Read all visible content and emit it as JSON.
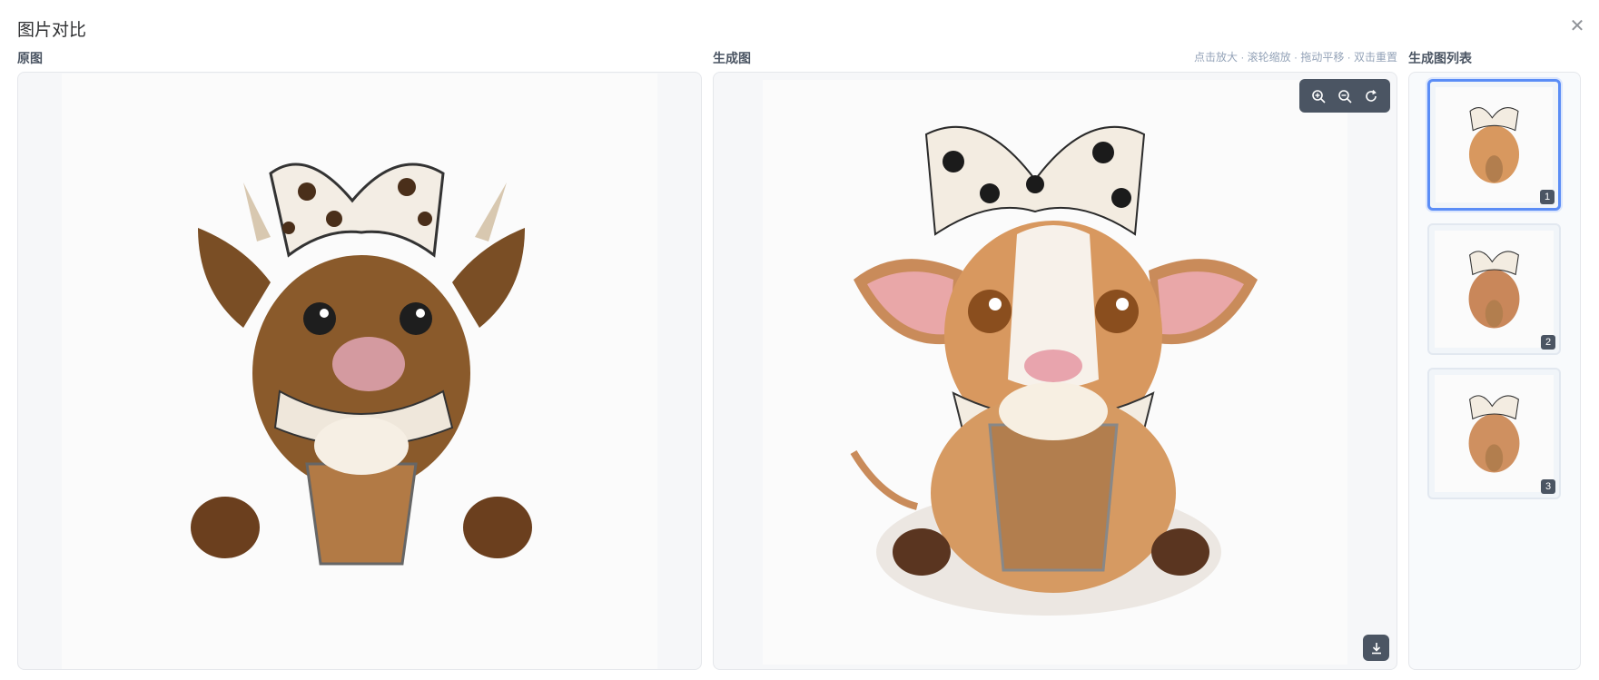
{
  "dialog": {
    "title": "图片对比",
    "close_icon": "close-icon"
  },
  "original": {
    "label": "原图"
  },
  "generated": {
    "label": "生成图",
    "hint": "点击放大 · 滚轮缩放 · 拖动平移 · 双击重置",
    "toolbar": {
      "zoom_in_icon": "zoom-in-icon",
      "zoom_out_icon": "zoom-out-icon",
      "reset_icon": "reset-icon"
    },
    "download_icon": "download-icon"
  },
  "list": {
    "label": "生成图列表",
    "thumbnails": [
      {
        "index": "1",
        "selected": true
      },
      {
        "index": "2",
        "selected": false
      },
      {
        "index": "3",
        "selected": false
      }
    ]
  },
  "colors": {
    "accent": "#5b8df6",
    "toolbar": "#4b5563",
    "panel_bg": "#f6f7f9"
  }
}
